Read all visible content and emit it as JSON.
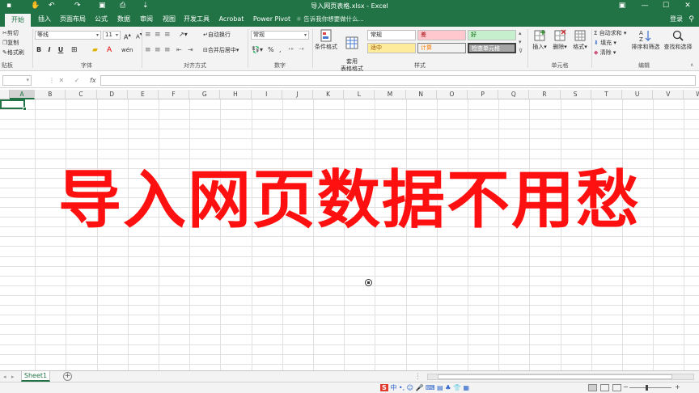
{
  "window": {
    "title": "导入网页表格.xlsx - Excel",
    "qa_more": "⇣",
    "min": "—",
    "max": "☐",
    "close": "✕",
    "ribbon_options": "▣"
  },
  "tabs": [
    {
      "label": "开始",
      "active": true
    },
    {
      "label": "插入"
    },
    {
      "label": "页面布局"
    },
    {
      "label": "公式"
    },
    {
      "label": "数据"
    },
    {
      "label": "审阅"
    },
    {
      "label": "视图"
    },
    {
      "label": "开发工具"
    },
    {
      "label": "Acrobat"
    },
    {
      "label": "Power Pivot"
    }
  ],
  "tell_me": "告诉我你想要做什么...",
  "login": "登录",
  "ribbon": {
    "clipboard": {
      "cut": "剪切",
      "copy": "复制",
      "painter": "格式刷",
      "label": "贴板"
    },
    "font": {
      "name": "等线",
      "size": "11",
      "bold": "B",
      "italic": "I",
      "underline": "U",
      "wen": "wén",
      "label": "字体"
    },
    "alignment": {
      "wrap": "自动换行",
      "merge": "合并后居中",
      "label": "对齐方式"
    },
    "number": {
      "format": "常规",
      "percent": "%",
      "comma": ",",
      "label": "数字"
    },
    "styles": {
      "conditional": "条件格式",
      "table": "套用\n表格格式",
      "normal": "常规",
      "bad": "差",
      "good": "好",
      "neutral": "适中",
      "calc": "计算",
      "check": "检查单元格",
      "label": "样式"
    },
    "cells": {
      "insert": "插入",
      "delete": "删除",
      "format": "格式",
      "label": "单元格"
    },
    "editing": {
      "autosum": "自动求和",
      "fill": "填充",
      "clear": "清除",
      "sort": "排序和筛选",
      "find": "查找和选择",
      "label": "编辑"
    }
  },
  "formula_bar": {
    "fx": "fx",
    "cancel": "✕",
    "enter": "✓"
  },
  "columns": [
    "A",
    "B",
    "C",
    "D",
    "E",
    "F",
    "G",
    "H",
    "I",
    "J",
    "K",
    "L",
    "M",
    "N",
    "O",
    "P",
    "Q",
    "R",
    "S",
    "T",
    "U",
    "V",
    "W"
  ],
  "headline": "导入网页数据不用愁",
  "sheets": [
    {
      "name": "Sheet1"
    }
  ],
  "add_sheet": "+",
  "status": {
    "ime": "中",
    "ime_extra": "•, ☺ 🎤 ⌨ ▤ ♣ 👕 ▦",
    "zoom_minus": "−",
    "zoom_plus": "+"
  },
  "colors": {
    "excel_green": "#217346",
    "headline_red": "#ff1010"
  }
}
